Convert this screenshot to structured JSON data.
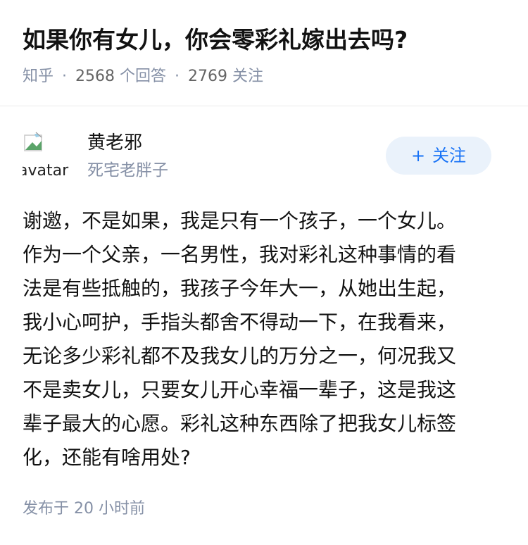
{
  "question": {
    "title": "如果你有女儿，你会零彩礼嫁出去吗?",
    "source": "知乎",
    "answer_count": "2568",
    "answer_label": "个回答",
    "follower_count": "2769",
    "follower_label": "关注"
  },
  "author": {
    "name": "黄老邪",
    "headline": "死宅老胖子",
    "avatar_alt": "avatar",
    "follow_label": "关注",
    "follow_icon": "plus-icon"
  },
  "answer": {
    "lines": [
      "谢邀，不是如果，我是只有一个孩子，一个女儿。",
      "作为一个父亲，一名男性，我对彩礼这种事情的看",
      "法是有些抵触的，我孩子今年大一，从她出生起，",
      "我小心呵护，手指头都舍不得动一下，在我看来，",
      "无论多少彩礼都不及我女儿的万分之一，何况我又",
      "不是卖女儿，只要女儿开心幸福一辈子，这是我这",
      "辈子最大的心愿。彩礼这种东西除了把我女儿标签",
      "化，还能有啥用处?"
    ],
    "published": "发布于  20 小时前"
  },
  "colors": {
    "accent": "#1772f6",
    "follow_bg": "#eaf2fb",
    "meta": "#8590a6"
  }
}
